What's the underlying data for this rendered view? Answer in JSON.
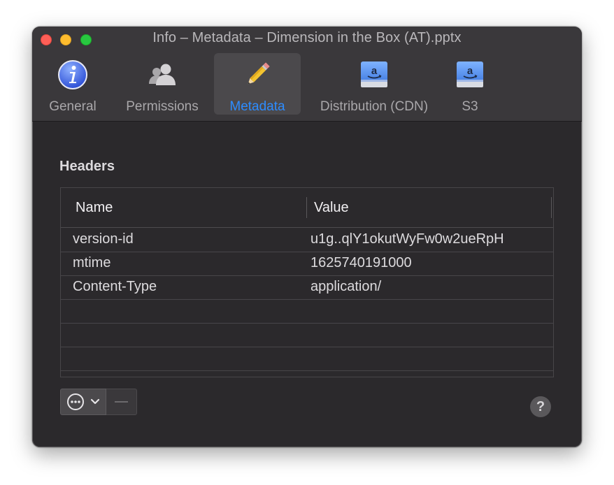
{
  "window": {
    "title": "Info – Metadata – Dimension in the Box (AT).pptx"
  },
  "tabs": [
    {
      "label": "General",
      "icon": "info-icon",
      "active": false
    },
    {
      "label": "Permissions",
      "icon": "people-icon",
      "active": false
    },
    {
      "label": "Metadata",
      "icon": "pencil-icon",
      "active": true
    },
    {
      "label": "Distribution (CDN)",
      "icon": "amazon-drive-icon",
      "active": false
    },
    {
      "label": "S3",
      "icon": "amazon-drive-icon",
      "active": false
    }
  ],
  "headers": {
    "section_title": "Headers",
    "columns": {
      "name": "Name",
      "value": "Value"
    },
    "rows": [
      {
        "name": "version-id",
        "value": "u1g..qlY1okutWyFw0w2ueRpH"
      },
      {
        "name": "mtime",
        "value": "1625740191000"
      },
      {
        "name": "Content-Type",
        "value": "application/"
      }
    ]
  },
  "footer": {
    "action_button_icon": "ellipsis-circle-icon",
    "minus_label": "—",
    "help_label": "?"
  },
  "colors": {
    "accent": "#2d8cff",
    "window_bg": "#2b292c",
    "toolbar_bg": "#3a383b",
    "close": "#fe5f57",
    "minimize": "#febc2e",
    "maximize": "#28c840"
  }
}
